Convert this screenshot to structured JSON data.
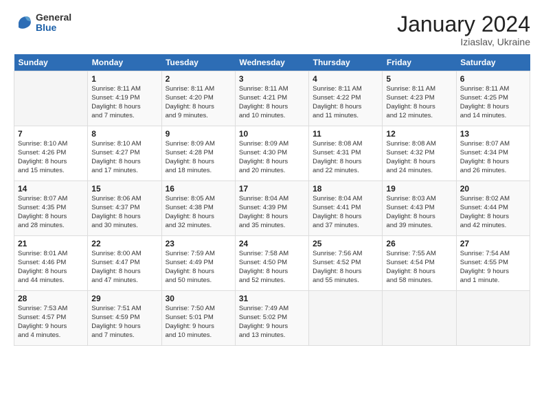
{
  "logo": {
    "general": "General",
    "blue": "Blue"
  },
  "title": "January 2024",
  "subtitle": "Iziaslav, Ukraine",
  "weekdays": [
    "Sunday",
    "Monday",
    "Tuesday",
    "Wednesday",
    "Thursday",
    "Friday",
    "Saturday"
  ],
  "weeks": [
    [
      {
        "day": "",
        "info": ""
      },
      {
        "day": "1",
        "info": "Sunrise: 8:11 AM\nSunset: 4:19 PM\nDaylight: 8 hours\nand 7 minutes."
      },
      {
        "day": "2",
        "info": "Sunrise: 8:11 AM\nSunset: 4:20 PM\nDaylight: 8 hours\nand 9 minutes."
      },
      {
        "day": "3",
        "info": "Sunrise: 8:11 AM\nSunset: 4:21 PM\nDaylight: 8 hours\nand 10 minutes."
      },
      {
        "day": "4",
        "info": "Sunrise: 8:11 AM\nSunset: 4:22 PM\nDaylight: 8 hours\nand 11 minutes."
      },
      {
        "day": "5",
        "info": "Sunrise: 8:11 AM\nSunset: 4:23 PM\nDaylight: 8 hours\nand 12 minutes."
      },
      {
        "day": "6",
        "info": "Sunrise: 8:11 AM\nSunset: 4:25 PM\nDaylight: 8 hours\nand 14 minutes."
      }
    ],
    [
      {
        "day": "7",
        "info": "Sunrise: 8:10 AM\nSunset: 4:26 PM\nDaylight: 8 hours\nand 15 minutes."
      },
      {
        "day": "8",
        "info": "Sunrise: 8:10 AM\nSunset: 4:27 PM\nDaylight: 8 hours\nand 17 minutes."
      },
      {
        "day": "9",
        "info": "Sunrise: 8:09 AM\nSunset: 4:28 PM\nDaylight: 8 hours\nand 18 minutes."
      },
      {
        "day": "10",
        "info": "Sunrise: 8:09 AM\nSunset: 4:30 PM\nDaylight: 8 hours\nand 20 minutes."
      },
      {
        "day": "11",
        "info": "Sunrise: 8:08 AM\nSunset: 4:31 PM\nDaylight: 8 hours\nand 22 minutes."
      },
      {
        "day": "12",
        "info": "Sunrise: 8:08 AM\nSunset: 4:32 PM\nDaylight: 8 hours\nand 24 minutes."
      },
      {
        "day": "13",
        "info": "Sunrise: 8:07 AM\nSunset: 4:34 PM\nDaylight: 8 hours\nand 26 minutes."
      }
    ],
    [
      {
        "day": "14",
        "info": "Sunrise: 8:07 AM\nSunset: 4:35 PM\nDaylight: 8 hours\nand 28 minutes."
      },
      {
        "day": "15",
        "info": "Sunrise: 8:06 AM\nSunset: 4:37 PM\nDaylight: 8 hours\nand 30 minutes."
      },
      {
        "day": "16",
        "info": "Sunrise: 8:05 AM\nSunset: 4:38 PM\nDaylight: 8 hours\nand 32 minutes."
      },
      {
        "day": "17",
        "info": "Sunrise: 8:04 AM\nSunset: 4:39 PM\nDaylight: 8 hours\nand 35 minutes."
      },
      {
        "day": "18",
        "info": "Sunrise: 8:04 AM\nSunset: 4:41 PM\nDaylight: 8 hours\nand 37 minutes."
      },
      {
        "day": "19",
        "info": "Sunrise: 8:03 AM\nSunset: 4:43 PM\nDaylight: 8 hours\nand 39 minutes."
      },
      {
        "day": "20",
        "info": "Sunrise: 8:02 AM\nSunset: 4:44 PM\nDaylight: 8 hours\nand 42 minutes."
      }
    ],
    [
      {
        "day": "21",
        "info": "Sunrise: 8:01 AM\nSunset: 4:46 PM\nDaylight: 8 hours\nand 44 minutes."
      },
      {
        "day": "22",
        "info": "Sunrise: 8:00 AM\nSunset: 4:47 PM\nDaylight: 8 hours\nand 47 minutes."
      },
      {
        "day": "23",
        "info": "Sunrise: 7:59 AM\nSunset: 4:49 PM\nDaylight: 8 hours\nand 50 minutes."
      },
      {
        "day": "24",
        "info": "Sunrise: 7:58 AM\nSunset: 4:50 PM\nDaylight: 8 hours\nand 52 minutes."
      },
      {
        "day": "25",
        "info": "Sunrise: 7:56 AM\nSunset: 4:52 PM\nDaylight: 8 hours\nand 55 minutes."
      },
      {
        "day": "26",
        "info": "Sunrise: 7:55 AM\nSunset: 4:54 PM\nDaylight: 8 hours\nand 58 minutes."
      },
      {
        "day": "27",
        "info": "Sunrise: 7:54 AM\nSunset: 4:55 PM\nDaylight: 9 hours\nand 1 minute."
      }
    ],
    [
      {
        "day": "28",
        "info": "Sunrise: 7:53 AM\nSunset: 4:57 PM\nDaylight: 9 hours\nand 4 minutes."
      },
      {
        "day": "29",
        "info": "Sunrise: 7:51 AM\nSunset: 4:59 PM\nDaylight: 9 hours\nand 7 minutes."
      },
      {
        "day": "30",
        "info": "Sunrise: 7:50 AM\nSunset: 5:01 PM\nDaylight: 9 hours\nand 10 minutes."
      },
      {
        "day": "31",
        "info": "Sunrise: 7:49 AM\nSunset: 5:02 PM\nDaylight: 9 hours\nand 13 minutes."
      },
      {
        "day": "",
        "info": ""
      },
      {
        "day": "",
        "info": ""
      },
      {
        "day": "",
        "info": ""
      }
    ]
  ]
}
